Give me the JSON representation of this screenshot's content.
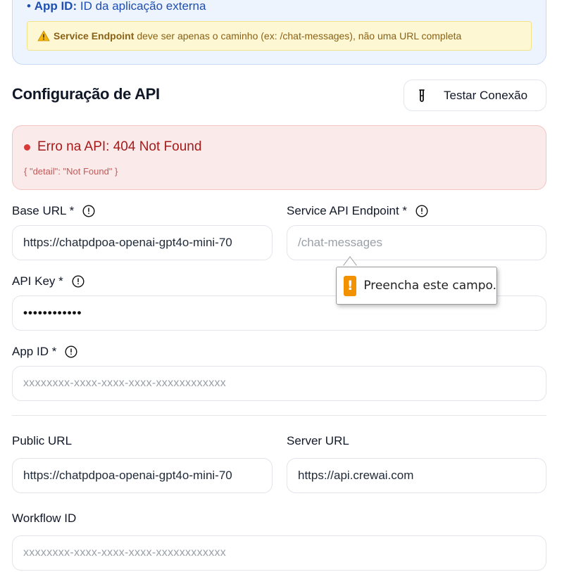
{
  "info_card": {
    "app_id_key": "App ID:",
    "app_id_desc": "ID da aplicação externa",
    "warning_bold": "Service Endpoint",
    "warning_text": "deve ser apenas o caminho (ex: /chat-messages), não uma URL completa"
  },
  "section": {
    "title": "Configuração de API",
    "test_button_label": "Testar Conexão"
  },
  "error": {
    "title": "Erro na API: 404 Not Found",
    "detail": "{ \"detail\": \"Not Found\" }"
  },
  "fields": {
    "base_url": {
      "label": "Base URL *",
      "value": "https://chatpdpoa-openai-gpt4o-mini-70"
    },
    "service_endpoint": {
      "label": "Service API Endpoint *",
      "placeholder": "/chat-messages"
    },
    "api_key": {
      "label": "API Key *",
      "value": "••••••••••••"
    },
    "app_id": {
      "label": "App ID *",
      "placeholder": "xxxxxxxx-xxxx-xxxx-xxxx-xxxxxxxxxxxx"
    },
    "public_url": {
      "label": "Public URL",
      "value": "https://chatpdpoa-openai-gpt4o-mini-70"
    },
    "server_url": {
      "label": "Server URL",
      "value": "https://api.crewai.com"
    },
    "workflow_id": {
      "label": "Workflow ID",
      "placeholder": "xxxxxxxx-xxxx-xxxx-xxxx-xxxxxxxxxxxx"
    }
  },
  "validation_tooltip": {
    "icon": "!",
    "message": "Preencha este campo."
  },
  "colors": {
    "accent_blue": "#1f4fb0",
    "error_red": "#a61b1b",
    "warning_orange": "#f39200"
  }
}
